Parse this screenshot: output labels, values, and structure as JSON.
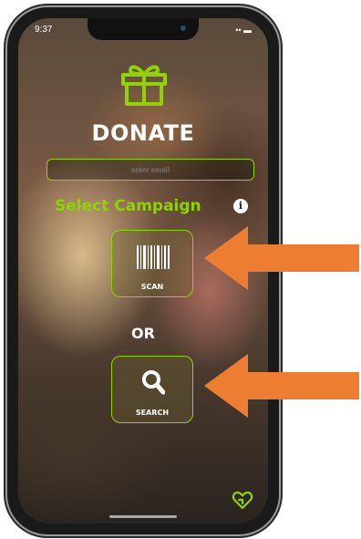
{
  "status_bar": {
    "time": "9:37",
    "indicators": "•• ▬"
  },
  "header": {
    "title": "DONATE",
    "icon": "gift-icon"
  },
  "email_field": {
    "placeholder": "enter email"
  },
  "campaign": {
    "heading": "Select Campaign",
    "info_glyph": "i"
  },
  "scan_button": {
    "label": "SCAN",
    "icon": "barcode-icon"
  },
  "separator": {
    "text": "OR"
  },
  "search_button": {
    "label": "SEARCH",
    "icon": "search-icon"
  },
  "footer": {
    "icon": "heart-icon"
  },
  "colors": {
    "accent": "#8fd400",
    "annotation_arrow": "#ed7d31"
  }
}
